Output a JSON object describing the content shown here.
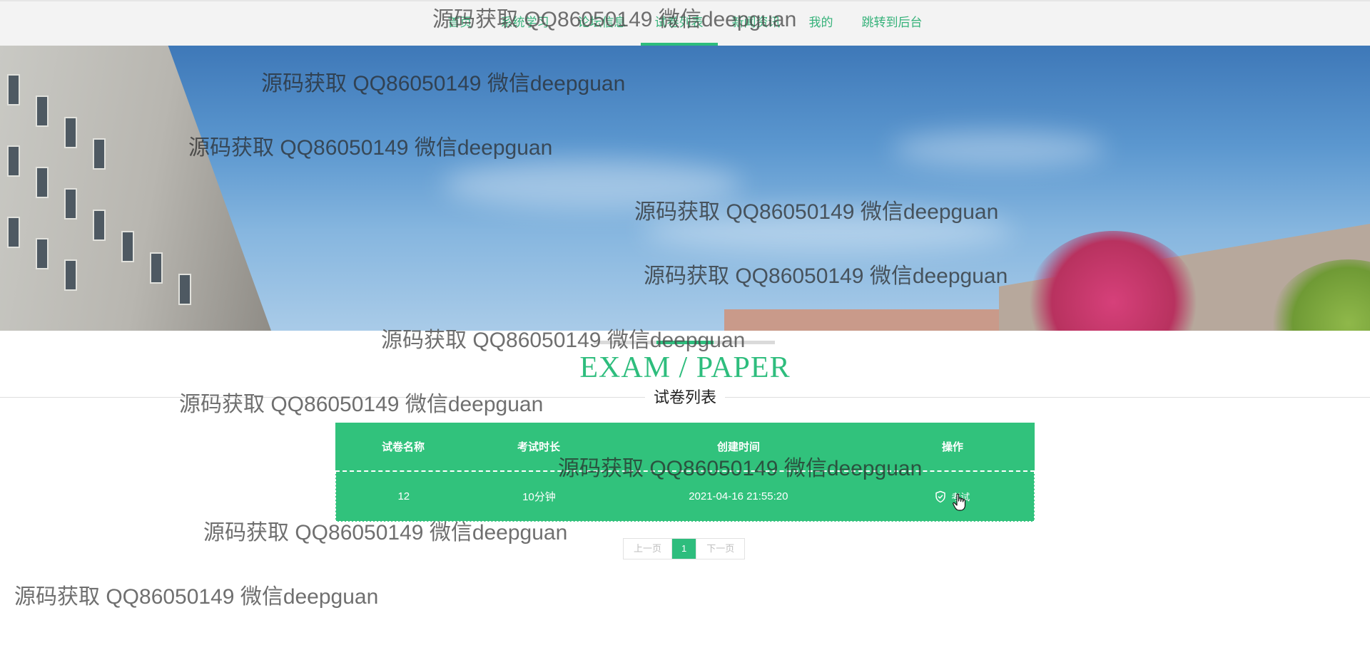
{
  "nav": {
    "items": [
      {
        "label": "首页"
      },
      {
        "label": "系统学习"
      },
      {
        "label": "论坛信息"
      },
      {
        "label": "试卷列表"
      },
      {
        "label": "新闻资讯"
      },
      {
        "label": "我的"
      },
      {
        "label": "跳转到后台"
      }
    ],
    "active_index": 3
  },
  "section": {
    "title_en": "EXAM / PAPER",
    "title_cn": "试卷列表"
  },
  "table": {
    "headers": [
      "试卷名称",
      "考试时长",
      "创建时间",
      "操作"
    ],
    "rows": [
      {
        "name": "12",
        "duration": "10分钟",
        "created": "2021-04-16 21:55:20",
        "action": "考试"
      }
    ]
  },
  "pagination": {
    "prev": "上一页",
    "current": "1",
    "next": "下一页"
  },
  "watermark": {
    "text": "源码获取 QQ86050149 微信deepguan"
  },
  "colors": {
    "accent": "#2ebd7d",
    "table_bg": "#31c27c",
    "nav_text": "#36b27a"
  },
  "icons": {
    "action": "shield-check-icon",
    "cursor": "hand-pointer-icon"
  }
}
